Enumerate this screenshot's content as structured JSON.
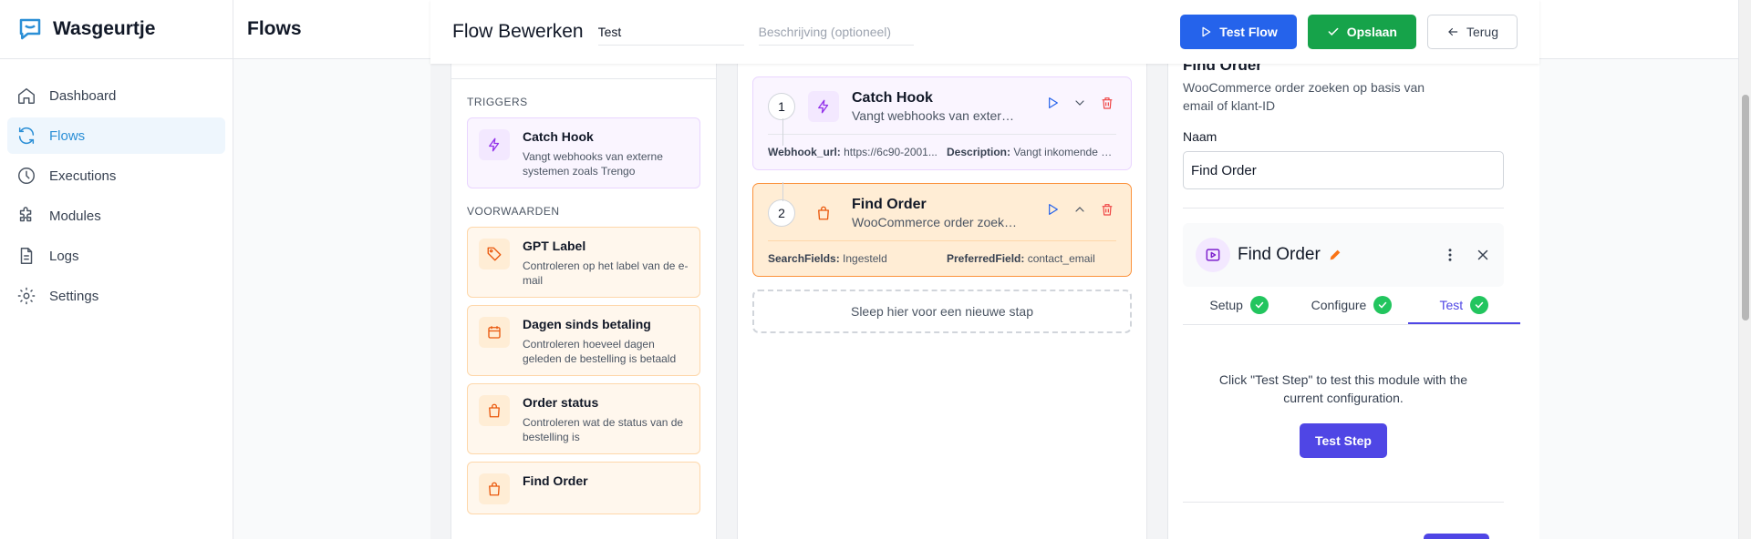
{
  "brand": {
    "name": "Wasgeurtje",
    "color": "#2b8fd6"
  },
  "sidebar": {
    "items": [
      {
        "label": "Dashboard",
        "icon": "home-icon"
      },
      {
        "label": "Flows",
        "icon": "refresh-icon",
        "active": true
      },
      {
        "label": "Executions",
        "icon": "clock-icon"
      },
      {
        "label": "Modules",
        "icon": "puzzle-icon"
      },
      {
        "label": "Logs",
        "icon": "document-icon"
      },
      {
        "label": "Settings",
        "icon": "gear-icon"
      }
    ]
  },
  "header": {
    "title": "Flows"
  },
  "editor": {
    "title": "Flow Bewerken",
    "name_value": "Test",
    "description_placeholder": "Beschrijving (optioneel)",
    "test_flow_label": "Test Flow",
    "save_label": "Opslaan",
    "back_label": "Terug"
  },
  "palette": {
    "triggers_heading": "TRIGGERS",
    "triggers": [
      {
        "title": "Catch Hook",
        "description": "Vangt webhooks van externe systemen zoals Trengo",
        "icon": "bolt-icon"
      }
    ],
    "conditions_heading": "VOORWAARDEN",
    "conditions": [
      {
        "title": "GPT Label",
        "description": "Controleren op het label van de e-mail",
        "icon": "tag-icon"
      },
      {
        "title": "Dagen sinds betaling",
        "description": "Controleren hoeveel dagen geleden de bestelling is betaald",
        "icon": "calendar-icon"
      },
      {
        "title": "Order status",
        "description": "Controleren wat de status van de bestelling is",
        "icon": "bag-icon"
      },
      {
        "title": "Find Order",
        "description": "",
        "icon": "bag-icon"
      }
    ]
  },
  "flow": {
    "steps": [
      {
        "number": "1",
        "name": "Catch Hook",
        "description": "Vangt webhooks van externe systemen zoals Trengo",
        "params": [
          {
            "key": "Webhook_url:",
            "value": "https://6c90-2001..."
          },
          {
            "key": "Description:",
            "value": "Vangt inkomende w..."
          }
        ]
      },
      {
        "number": "2",
        "name": "Find Order",
        "description": "WooCommerce order zoeken op basis van email",
        "params": [
          {
            "key": "SearchFields:",
            "value": "Ingesteld"
          },
          {
            "key": "PreferredField:",
            "value": "contact_email"
          }
        ]
      }
    ],
    "dropzone_label": "Sleep hier voor een nieuwe stap"
  },
  "panel": {
    "title": "Find Order",
    "description": "WooCommerce order zoeken op basis van email of klant-ID",
    "name_label": "Naam",
    "name_value": "Find Order",
    "module_name": "Find Order",
    "tabs": [
      {
        "label": "Setup"
      },
      {
        "label": "Configure"
      },
      {
        "label": "Test",
        "active": true
      }
    ],
    "test_message": "Click \"Test Step\" to test this module with the current configuration.",
    "test_button_label": "Test Step"
  }
}
